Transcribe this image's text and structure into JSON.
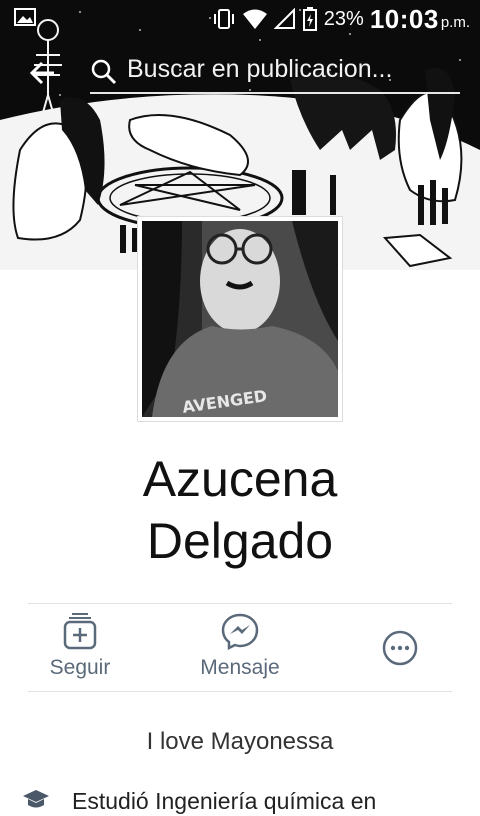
{
  "status_bar": {
    "battery": "23%",
    "time": "10:03",
    "ampm": "p.m."
  },
  "search": {
    "placeholder": "Buscar en publicacion..."
  },
  "profile": {
    "name_first": "Azucena",
    "name_last": "Delgado",
    "shirt_text": "AVENGED"
  },
  "actions": {
    "follow": "Seguir",
    "message": "Mensaje"
  },
  "bio": "I love Mayonessa",
  "education": "Estudió Ingeniería química en"
}
